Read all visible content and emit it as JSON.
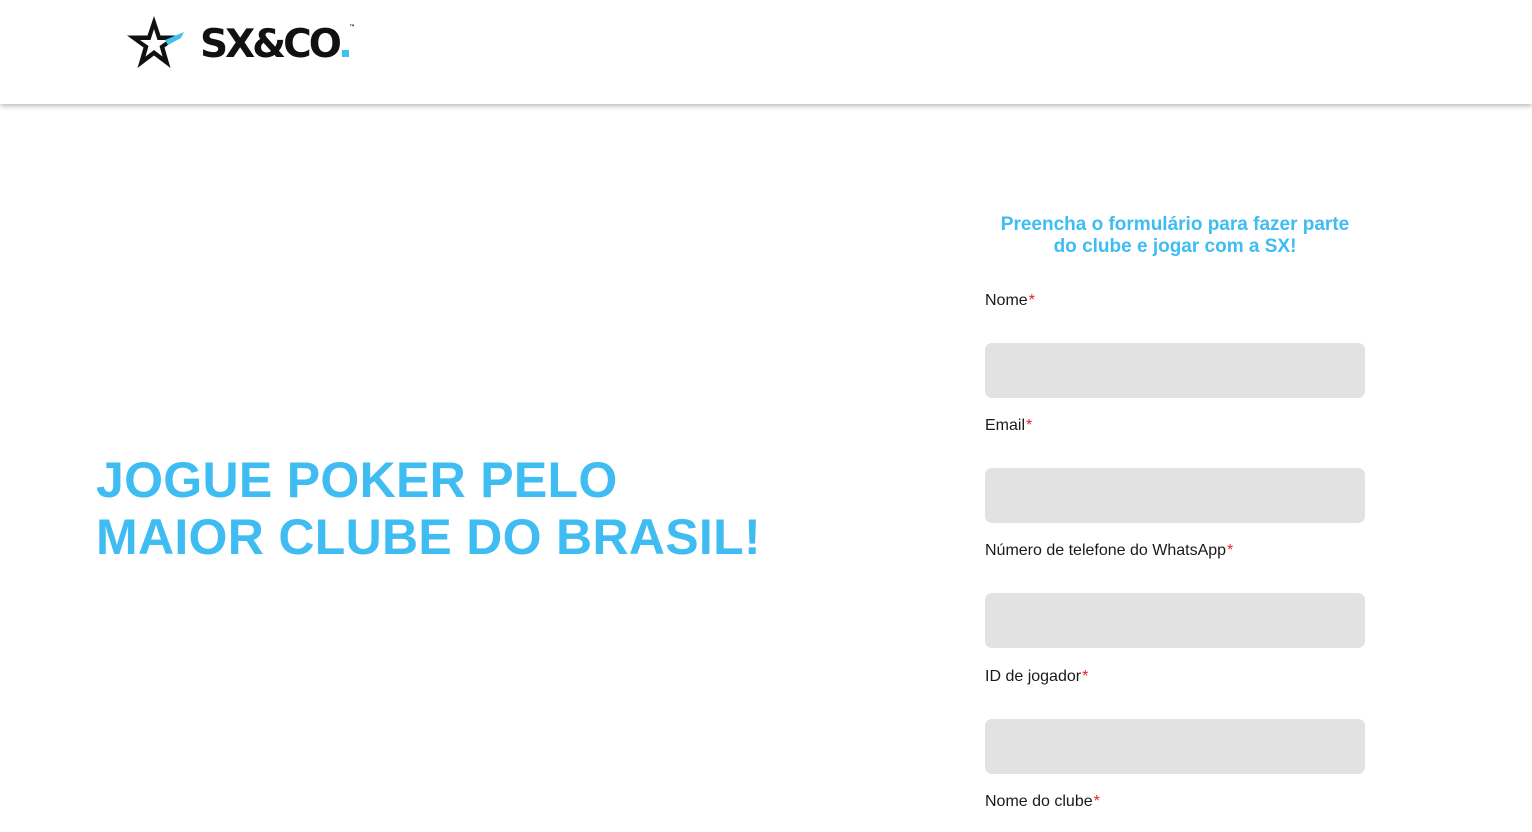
{
  "header": {
    "logo_text": "SX&CO",
    "logo_trademark": "™",
    "logo_icon": "star-icon",
    "brand_accent": "#3ec2ec"
  },
  "hero": {
    "line1": "JOGUE POKER PELO",
    "line2": "MAIOR CLUBE DO BRASIL!",
    "color": "#3fbcf2"
  },
  "form": {
    "title_line1": "Preencha o formulário para fazer parte",
    "title_line2": "do clube e jogar com a SX!",
    "required_marker": "*",
    "required_color": "#e0202e",
    "input_background": "#e2e2e2",
    "fields": [
      {
        "label": "Nome",
        "value": ""
      },
      {
        "label": "Email",
        "value": ""
      },
      {
        "label": "Número de telefone do WhatsApp",
        "value": ""
      },
      {
        "label": "ID de jogador",
        "value": ""
      },
      {
        "label": "Nome do clube",
        "value": ""
      }
    ]
  }
}
